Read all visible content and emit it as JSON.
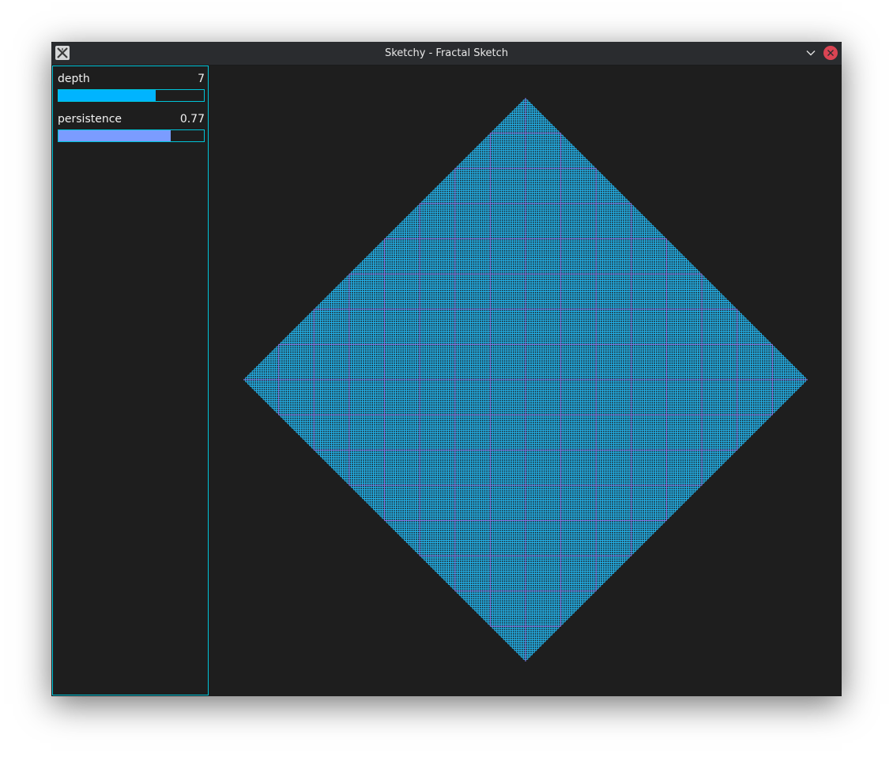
{
  "window": {
    "title": "Sketchy - Fractal Sketch",
    "app_icon": "x-app-icon",
    "buttons": {
      "minimize_icon": "chevron-down-icon",
      "close_icon": "close-icon"
    }
  },
  "controls": {
    "depth": {
      "label": "depth",
      "value": "7",
      "fill_fraction": 0.666,
      "color": "#00b4ff"
    },
    "persistence": {
      "label": "persistence",
      "value": "0.77",
      "fill_fraction": 0.77,
      "color": "#7b9cff"
    }
  },
  "fractal": {
    "style": "crosses",
    "primary_color": "#22b0e8",
    "accent_color": "#e040e0",
    "background": "#1e1e1e"
  }
}
